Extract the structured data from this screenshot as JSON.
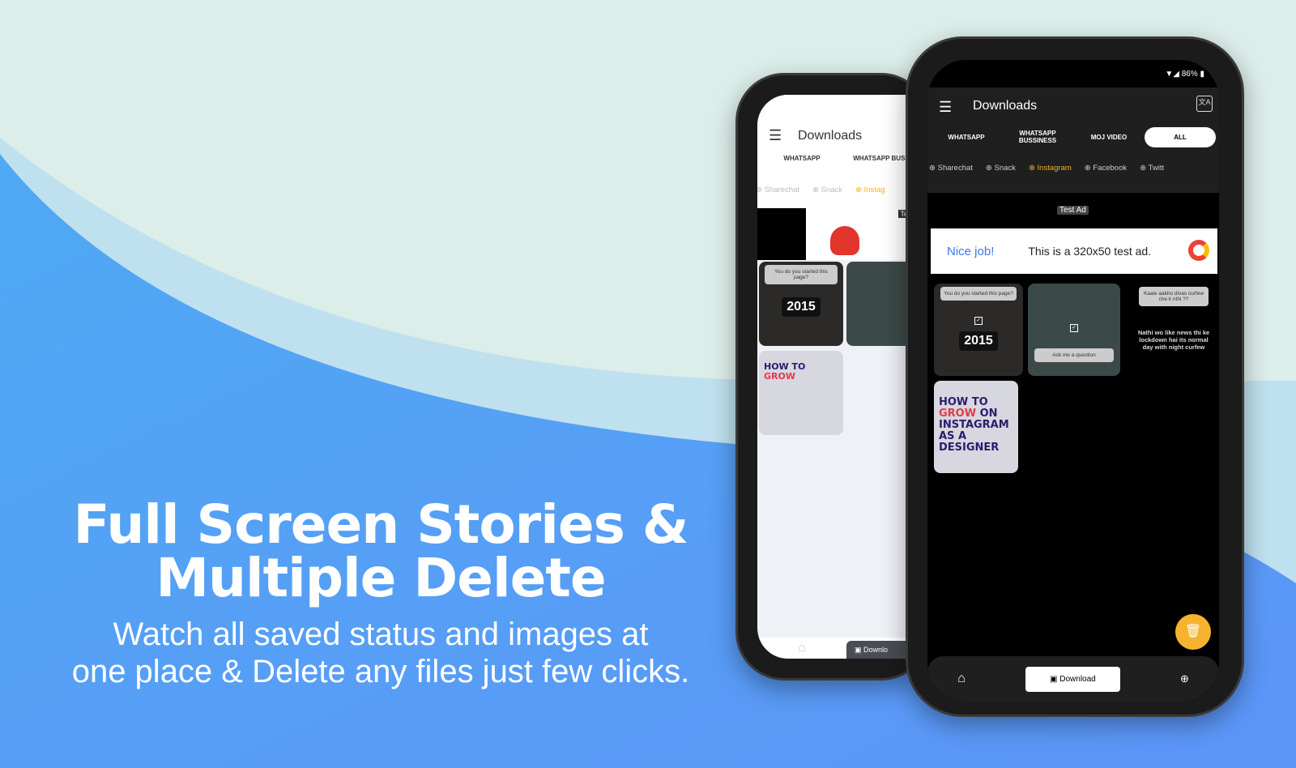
{
  "promo": {
    "headline_line1": "Full Screen Stories &",
    "headline_line2": "Multiple Delete",
    "subtitle_line1": "Watch all saved status and images at",
    "subtitle_line2": "one place & Delete any files just few clicks."
  },
  "colors": {
    "background_top": "#dceeea",
    "wave_blue": "#55a5f3",
    "accent_yellow": "#f7b330",
    "ad_blue": "#3b78e7"
  },
  "status_bar": {
    "battery": "86%"
  },
  "app": {
    "title": "Downloads",
    "tabs": [
      {
        "label": "WHATSAPP"
      },
      {
        "label": "WHATSAPP BUSSINESS"
      },
      {
        "label": "MOJ VIDEO"
      },
      {
        "label": "ALL",
        "active": true
      }
    ],
    "sources": [
      {
        "label": "Sharechat"
      },
      {
        "label": "Snack"
      },
      {
        "label": "Instagram",
        "active": true
      },
      {
        "label": "Facebook"
      },
      {
        "label": "Twitt"
      }
    ],
    "ad": {
      "label": "Test Ad",
      "headline": "Nice job!",
      "text": "This is a 320x50 test ad."
    },
    "thumbnails": [
      {
        "question": "You do you started this page?",
        "caption": "2015",
        "selected": true
      },
      {
        "question": "Ask me a question",
        "selected": true
      },
      {
        "question": "Kaale aakho divas curfew che k nthi ??",
        "caption": "Nathi wo like news thi ke lockdown hai its normal day with night curfew",
        "selected": false
      },
      {
        "caption_a": "HOW TO",
        "caption_b": "GROW",
        "caption_c": "ON INSTAGRAM AS A DESIGNER",
        "selected": false
      }
    ],
    "fab": "delete-icon",
    "bottom_nav": [
      {
        "icon": "home-icon"
      },
      {
        "label": "Download",
        "active": true
      },
      {
        "icon": "download-icon"
      }
    ]
  },
  "back_phone": {
    "title": "Downloads",
    "tabs": [
      "WHATSAPP",
      "WHATSAPP BUSSINESS"
    ],
    "sources": [
      "Sharechat",
      "Snack",
      "Instag"
    ],
    "ad_label": "Test Ad",
    "bottom_label": "Downlo"
  }
}
